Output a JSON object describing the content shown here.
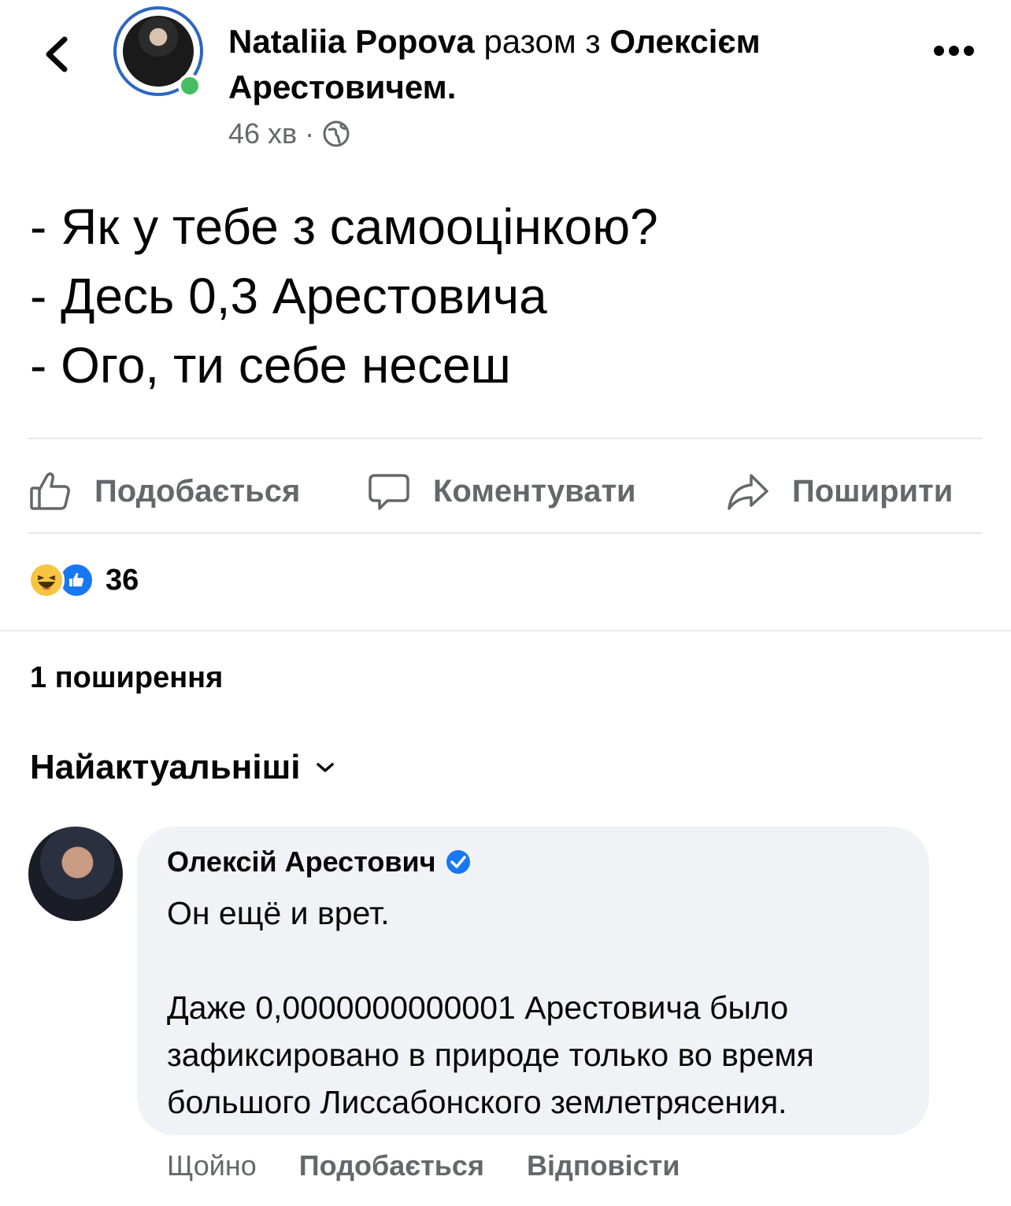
{
  "header": {
    "author": "Nataliia Popova",
    "with_text": "разом з",
    "tagged": "Олексієм Арестовичем.",
    "time": "46 хв",
    "separator": "·"
  },
  "post": {
    "text": "- Як у тебе з самооцінкою?\n- Десь 0,3 Арестовича\n- Ого, ти себе несеш"
  },
  "actions": {
    "like": "Подобається",
    "comment": "Коментувати",
    "share": "Поширити"
  },
  "reactions": {
    "count": "36",
    "types": [
      "haha",
      "like"
    ]
  },
  "shares": "1 поширення",
  "sort": {
    "label": "Найактуальніші"
  },
  "comment": {
    "author": "Олексій Арестович",
    "verified": true,
    "text": "Он ещё и врет.\n\nДаже 0,0000000000001 Арестовича было зафиксировано в природе только во время большого Лиссабонского землетрясения.",
    "time": "Щойно",
    "like": "Подобається",
    "reply": "Відповісти"
  },
  "colors": {
    "accent": "#1877f2",
    "muted": "#65676b",
    "bubble": "#f0f2f5",
    "online": "#45bd62"
  }
}
